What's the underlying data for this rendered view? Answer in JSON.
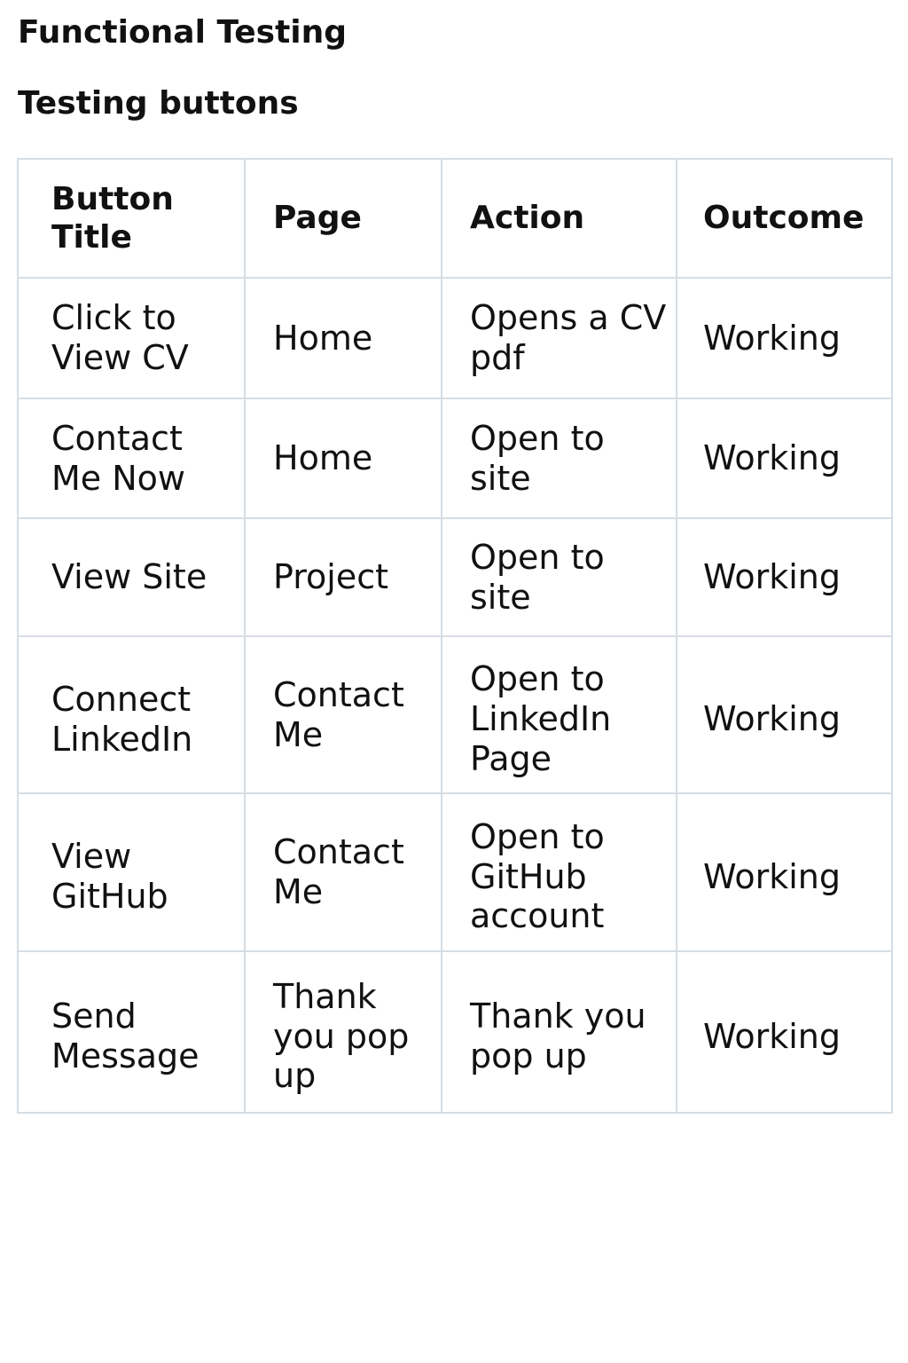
{
  "document": {
    "title": "Functional Testing",
    "subtitle": "Testing buttons"
  },
  "table": {
    "headers": [
      "Button Title",
      "Page",
      "Action",
      "Outcome"
    ],
    "rows": [
      [
        "Click to View CV",
        "Home",
        "Opens a CV pdf",
        "Working"
      ],
      [
        "Contact Me Now",
        "Home",
        "Open to site",
        "Working"
      ],
      [
        "View Site",
        "Project",
        "Open to site",
        "Working"
      ],
      [
        "Connect LinkedIn",
        "Contact Me",
        "Open to LinkedIn Page",
        "Working"
      ],
      [
        "View GitHub",
        "Contact Me",
        "Open to GitHub account",
        "Working"
      ],
      [
        "Send Message",
        "Thank you pop up",
        "Thank you pop up",
        "Working"
      ]
    ]
  }
}
